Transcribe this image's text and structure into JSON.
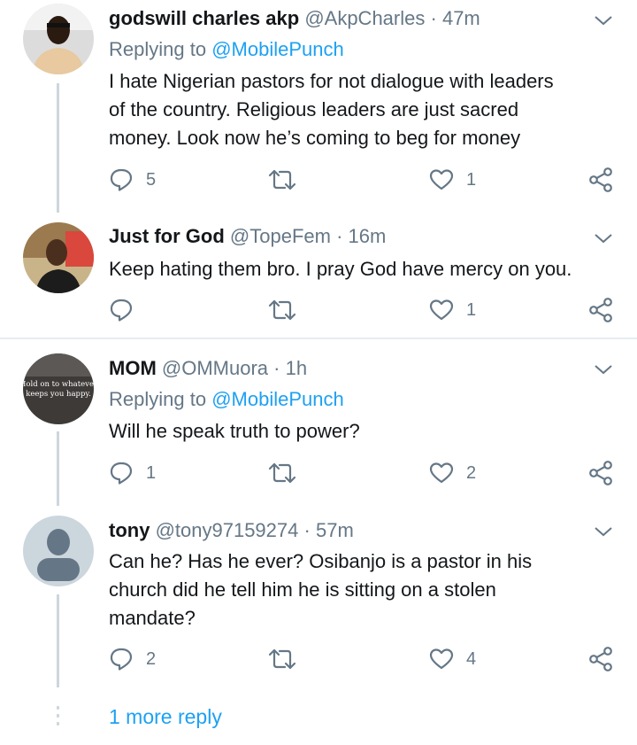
{
  "tweets": [
    {
      "name": "godswill charles akp",
      "handle": "@AkpCharles",
      "time": "47m",
      "replying_label": "Replying to",
      "replying_handle": "@MobilePunch",
      "lines": [
        "I hate Nigerian pastors for not dialogue with leaders",
        "of the country. Religious leaders are just sacred",
        "money. Look now he’s coming to beg for money"
      ],
      "reply_count": "5",
      "like_count": "1"
    },
    {
      "name": "Just for God",
      "handle": "@TopeFem",
      "time": "16m",
      "lines": [
        "Keep hating them bro. I pray God have mercy on you."
      ],
      "reply_count": "",
      "like_count": "1"
    },
    {
      "name": "MOM",
      "handle": "@OMMuora",
      "time": "1h",
      "avatar_text": [
        "Hold on to whatever",
        "keeps you happy."
      ],
      "replying_label": "Replying to",
      "replying_handle": "@MobilePunch",
      "lines": [
        "Will he speak truth to power?"
      ],
      "reply_count": "1",
      "like_count": "2"
    },
    {
      "name": "tony",
      "handle": "@tony97159274",
      "time": "57m",
      "lines": [
        "Can he? Has he ever? Osibanjo is a pastor in his",
        "church did he tell him he is sitting on a stolen",
        "mandate?"
      ],
      "reply_count": "2",
      "like_count": "4"
    }
  ],
  "separator": "·",
  "more_replies": "1 more reply",
  "colors": {
    "link": "#1da1f2",
    "muted": "#657786",
    "text": "#14171a",
    "line": "#ccd6dd"
  },
  "icons": [
    "reply-icon",
    "retweet-icon",
    "like-icon",
    "share-icon",
    "chevron-down-icon"
  ]
}
